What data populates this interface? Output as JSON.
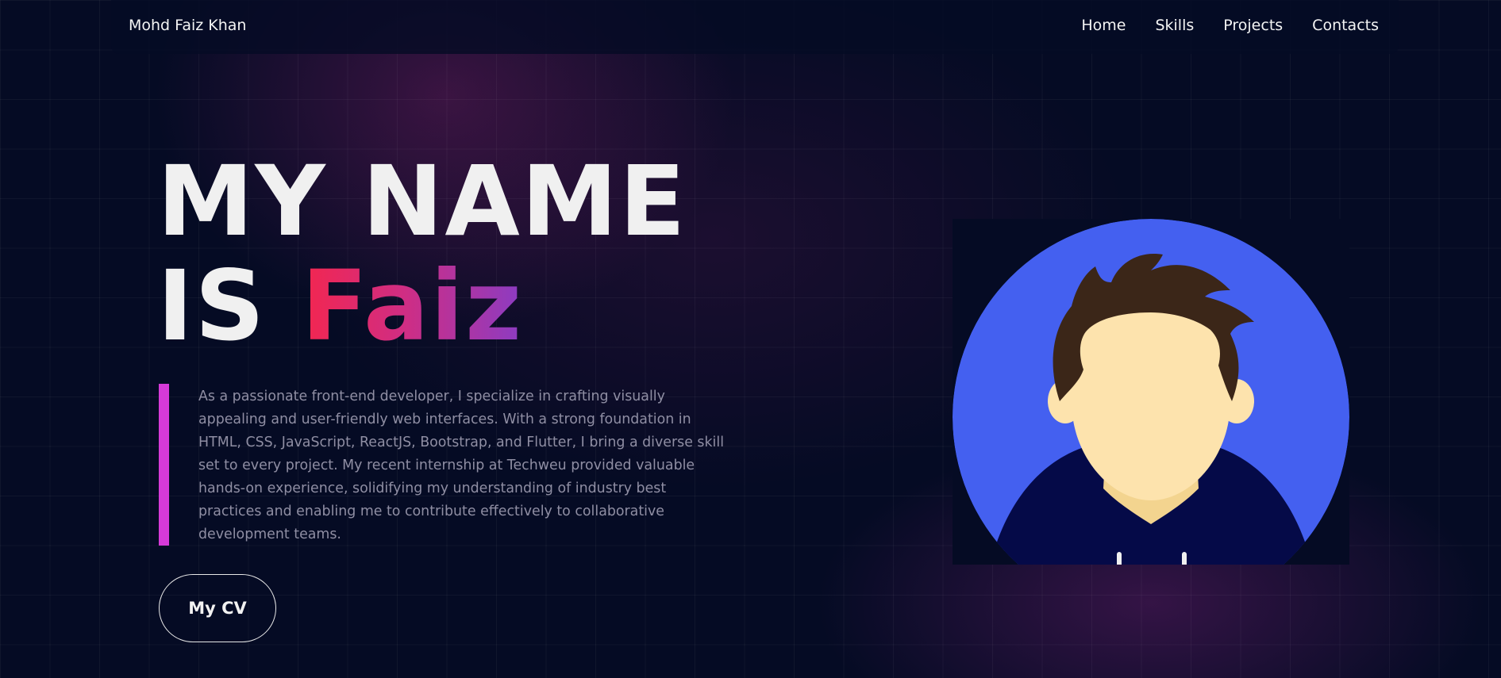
{
  "navbar": {
    "brand": "Mohd Faiz Khan",
    "links": [
      "Home",
      "Skills",
      "Projects",
      "Contacts"
    ]
  },
  "hero": {
    "title_line1": "MY NAME",
    "title_is": "IS",
    "title_name": "Faiz",
    "bio": "As a passionate front-end developer, I specialize in crafting visually appealing and user-friendly web interfaces. With a strong foundation in HTML, CSS, JavaScript, ReactJS, Bootstrap, and Flutter, I bring a diverse skill set to every project. My recent internship at Techweu provided valuable hands-on experience, solidifying my understanding of industry best practices and enabling me to contribute effectively to collaborative development teams.",
    "cv_button": "My CV"
  },
  "colors": {
    "background": "#050b24",
    "accent_bar": "#d63ad8",
    "name_gradient_start": "#f3264f",
    "name_gradient_end": "#8b3cc3",
    "avatar_circle": "#4460f0"
  },
  "avatar": {
    "icon": "user-avatar-illustration"
  }
}
